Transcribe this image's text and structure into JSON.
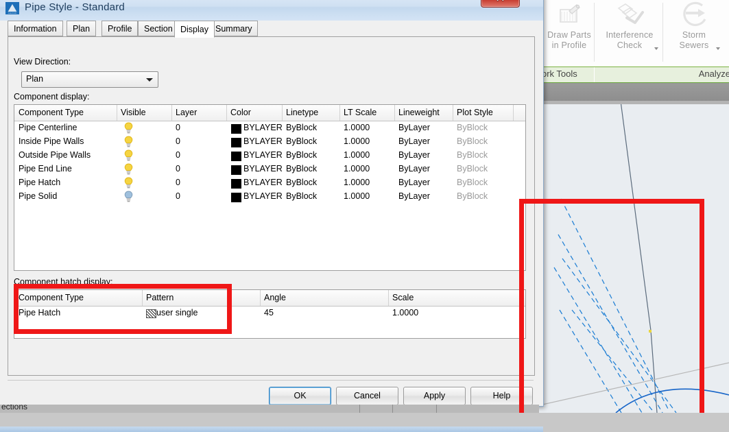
{
  "window": {
    "title": "Pipe Style - Standard",
    "icon": "autocad-app-icon",
    "close_label": "✕"
  },
  "tabs": [
    {
      "label": "Information",
      "active": false
    },
    {
      "label": "Plan",
      "active": false
    },
    {
      "label": "Profile",
      "active": false
    },
    {
      "label": "Section",
      "active": false
    },
    {
      "label": "Display",
      "active": true
    },
    {
      "label": "Summary",
      "active": false
    }
  ],
  "form": {
    "view_direction_label": "View Direction:",
    "view_direction_value": "Plan",
    "component_display_label": "Component display:",
    "component_hatch_label": "Component hatch display:"
  },
  "component_display": {
    "columns": [
      "Component Type",
      "Visible",
      "Layer",
      "Color",
      "Linetype",
      "LT Scale",
      "Lineweight",
      "Plot Style"
    ],
    "rows": [
      {
        "type": "Pipe Centerline",
        "visible": "on",
        "layer": "0",
        "color": "BYLAYER",
        "color_swatch": "#000000",
        "linetype": "ByBlock",
        "lt_scale": "1.0000",
        "lineweight": "ByLayer",
        "plot_style": "ByBlock"
      },
      {
        "type": "Inside Pipe Walls",
        "visible": "on",
        "layer": "0",
        "color": "BYLAYER",
        "color_swatch": "#000000",
        "linetype": "ByBlock",
        "lt_scale": "1.0000",
        "lineweight": "ByLayer",
        "plot_style": "ByBlock"
      },
      {
        "type": "Outside Pipe Walls",
        "visible": "on",
        "layer": "0",
        "color": "BYLAYER",
        "color_swatch": "#000000",
        "linetype": "ByBlock",
        "lt_scale": "1.0000",
        "lineweight": "ByLayer",
        "plot_style": "ByBlock"
      },
      {
        "type": "Pipe End Line",
        "visible": "on",
        "layer": "0",
        "color": "BYLAYER",
        "color_swatch": "#000000",
        "linetype": "ByBlock",
        "lt_scale": "1.0000",
        "lineweight": "ByLayer",
        "plot_style": "ByBlock"
      },
      {
        "type": "Pipe Hatch",
        "visible": "on",
        "layer": "0",
        "color": "BYLAYER",
        "color_swatch": "#000000",
        "linetype": "ByBlock",
        "lt_scale": "1.0000",
        "lineweight": "ByLayer",
        "plot_style": "ByBlock"
      },
      {
        "type": "Pipe Solid",
        "visible": "off",
        "layer": "0",
        "color": "BYLAYER",
        "color_swatch": "#000000",
        "linetype": "ByBlock",
        "lt_scale": "1.0000",
        "lineweight": "ByLayer",
        "plot_style": "ByBlock"
      }
    ]
  },
  "component_hatch": {
    "columns": [
      "Component Type",
      "Pattern",
      "",
      "Angle",
      "Scale"
    ],
    "rows": [
      {
        "type": "Pipe Hatch",
        "pattern": "user single",
        "angle": "45",
        "scale": "1.0000"
      }
    ]
  },
  "buttons": [
    {
      "label": "OK",
      "focused": true
    },
    {
      "label": "Cancel",
      "focused": false
    },
    {
      "label": "Apply",
      "focused": false
    },
    {
      "label": "Help",
      "focused": false
    }
  ],
  "background_app": {
    "ribbon_items": [
      {
        "label": "Draw Parts\nin Profile",
        "icon": "draw-parts-in-profile-icon",
        "has_arrow": false
      },
      {
        "label": "Interference\nCheck",
        "icon": "interference-check-icon",
        "has_arrow": true
      },
      {
        "label": "Storm\nSewers",
        "icon": "storm-sewers-icon",
        "has_arrow": true
      }
    ],
    "panel_labels": [
      "ork Tools",
      "Analyze"
    ],
    "taskbar_text": "ections"
  },
  "annotations": {
    "accent_color": "#ef1717",
    "boxes": [
      {
        "name": "hatch-table-highlight"
      },
      {
        "name": "drawing-region-highlight"
      }
    ]
  }
}
